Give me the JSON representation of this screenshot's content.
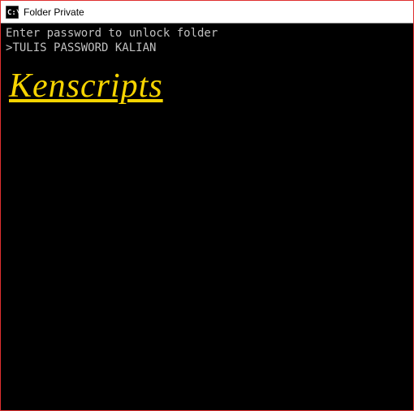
{
  "titlebar": {
    "title": "Folder Private"
  },
  "console": {
    "line1": "Enter password to unlock folder",
    "prompt_prefix": ">",
    "prompt_input": "TULIS PASSWORD KALIAN"
  },
  "watermark": {
    "text": "Kenscripts"
  }
}
